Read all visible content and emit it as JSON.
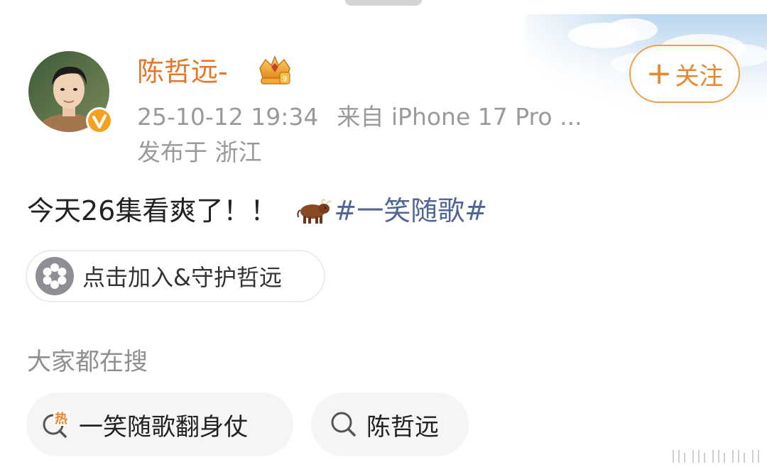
{
  "post": {
    "username": "陈哲远-",
    "timestamp": "25-10-12 19:34",
    "source": "来自 iPhone 17 Pro ...",
    "location": "发布于 浙江",
    "text": "今天26集看爽了！！",
    "emoji": "bull-emoji",
    "hashtag": "#一笑随歌#",
    "follow_label": "关注",
    "fan_chip_label": "点击加入&守护哲远"
  },
  "search": {
    "title": "大家都在搜",
    "chips": [
      {
        "label": "一笑随歌翻身仗",
        "icon": "hot-search-icon"
      },
      {
        "label": "陈哲远",
        "icon": "search-icon"
      }
    ]
  },
  "colors": {
    "username": "#e4772a",
    "follow_border": "#f0a04b",
    "hashtag": "#4f6596",
    "meta": "#9a9a9a",
    "chip_bg": "#f5f5f5"
  }
}
